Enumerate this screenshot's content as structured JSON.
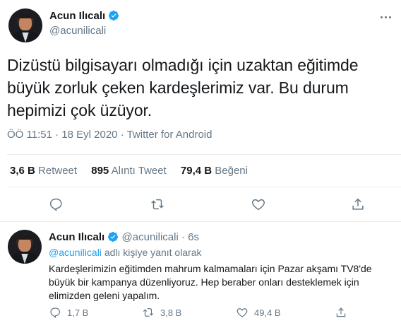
{
  "main_tweet": {
    "author_name": "Acun Ilıcalı",
    "author_handle": "@acunilicali",
    "text": "Dizüstü bilgisayarı olmadığı için uzaktan eğitimde büyük zorluk çeken kardeşlerimiz var. Bu durum hepimizi çok üzüyor.",
    "time": "ÖÖ 11:51",
    "separator": "·",
    "date": "18 Eyl 2020",
    "source": "Twitter for Android",
    "stats": {
      "retweets_value": "3,6 B",
      "retweets_label": "Retweet",
      "quotes_value": "895",
      "quotes_label": "Alıntı Tweet",
      "likes_value": "79,4 B",
      "likes_label": "Beğeni"
    }
  },
  "reply_tweet": {
    "author_name": "Acun Ilıcalı",
    "author_handle": "@acunilicali",
    "separator": "·",
    "age": "6s",
    "reply_mention": "@acunilicali",
    "reply_suffix": "adlı kişiye yanıt olarak",
    "text": "Kardeşlerimizin eğitimden mahrum kalmamaları için Pazar akşamı TV8'de büyük bir kampanya düzenliyoruz. Hep beraber onları desteklemek için elimizden geleni yapalım.",
    "replies": "1,7 B",
    "retweets": "3,8 B",
    "likes": "49,4 B"
  },
  "colors": {
    "accent": "#1da1f2",
    "text": "#14171a",
    "secondary": "#657786",
    "divider": "#e6ecf0"
  },
  "icons": {
    "verified": "verified-badge-icon",
    "reply": "reply-icon",
    "retweet": "retweet-icon",
    "like": "heart-icon",
    "share": "share-icon",
    "more": "more-icon"
  }
}
